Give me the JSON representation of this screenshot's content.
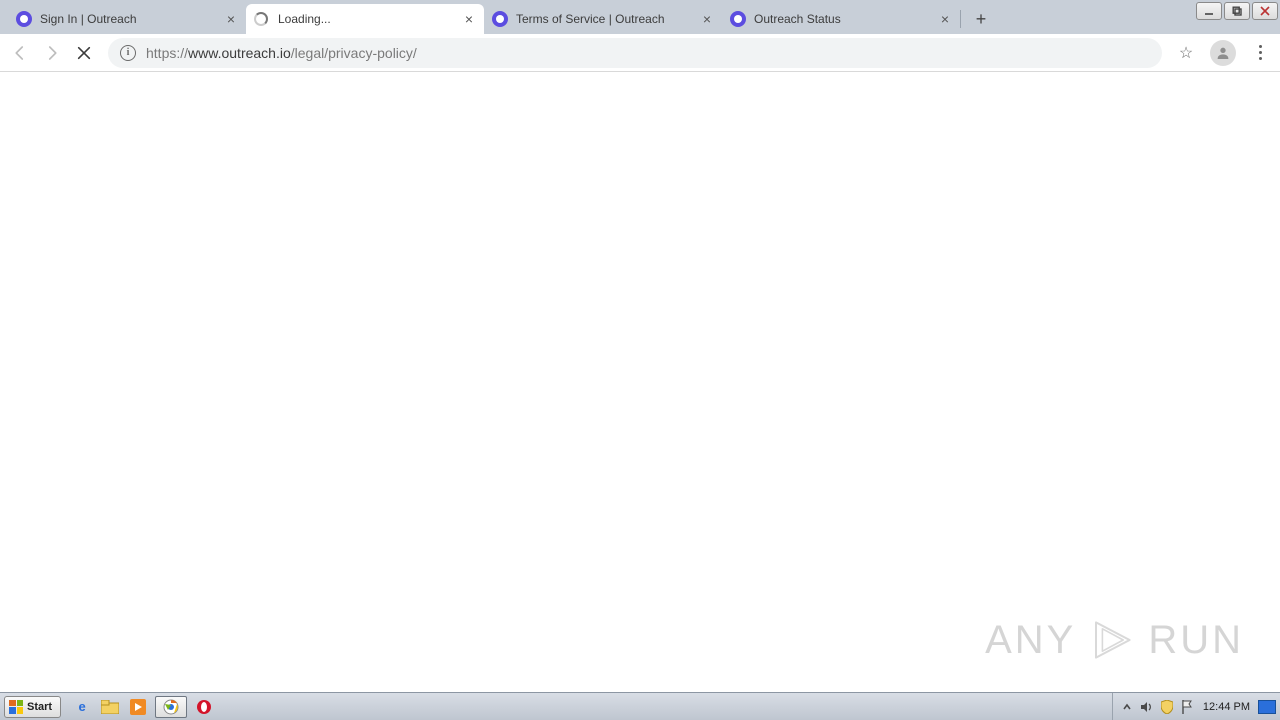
{
  "window_controls": {
    "minimize": "min",
    "maximize": "max",
    "close": "close"
  },
  "tabs": [
    {
      "title": "Sign In | Outreach",
      "active": false,
      "loading": false
    },
    {
      "title": "Loading...",
      "active": true,
      "loading": true
    },
    {
      "title": "Terms of Service | Outreach",
      "active": false,
      "loading": false
    },
    {
      "title": "Outreach Status",
      "active": false,
      "loading": false
    }
  ],
  "address_bar": {
    "scheme": "https://",
    "host": "www.outreach.io",
    "path": "/legal/privacy-policy/"
  },
  "watermark": {
    "left": "ANY",
    "right": "RUN"
  },
  "taskbar": {
    "start_label": "Start",
    "clock": "12:44 PM"
  }
}
